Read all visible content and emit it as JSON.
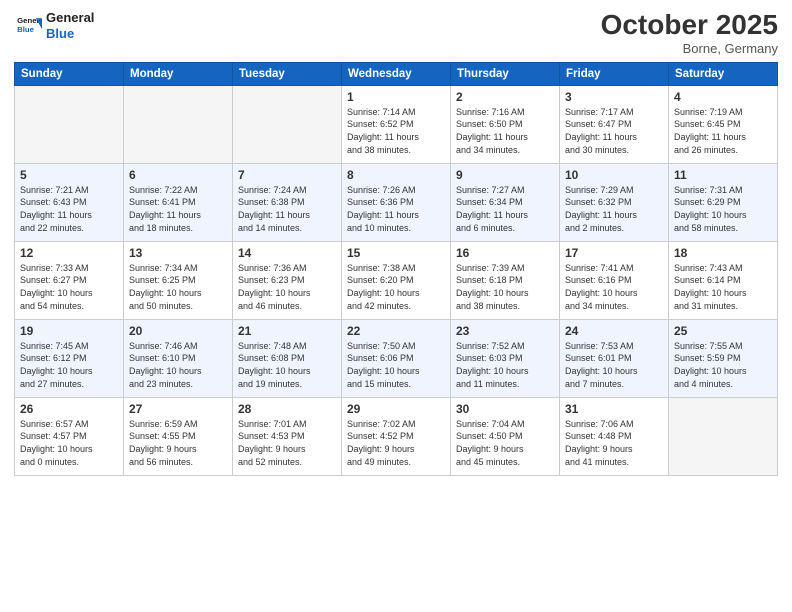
{
  "header": {
    "logo_line1": "General",
    "logo_line2": "Blue",
    "month": "October 2025",
    "location": "Borne, Germany"
  },
  "weekdays": [
    "Sunday",
    "Monday",
    "Tuesday",
    "Wednesday",
    "Thursday",
    "Friday",
    "Saturday"
  ],
  "weeks": [
    [
      {
        "day": "",
        "info": ""
      },
      {
        "day": "",
        "info": ""
      },
      {
        "day": "",
        "info": ""
      },
      {
        "day": "1",
        "info": "Sunrise: 7:14 AM\nSunset: 6:52 PM\nDaylight: 11 hours\nand 38 minutes."
      },
      {
        "day": "2",
        "info": "Sunrise: 7:16 AM\nSunset: 6:50 PM\nDaylight: 11 hours\nand 34 minutes."
      },
      {
        "day": "3",
        "info": "Sunrise: 7:17 AM\nSunset: 6:47 PM\nDaylight: 11 hours\nand 30 minutes."
      },
      {
        "day": "4",
        "info": "Sunrise: 7:19 AM\nSunset: 6:45 PM\nDaylight: 11 hours\nand 26 minutes."
      }
    ],
    [
      {
        "day": "5",
        "info": "Sunrise: 7:21 AM\nSunset: 6:43 PM\nDaylight: 11 hours\nand 22 minutes."
      },
      {
        "day": "6",
        "info": "Sunrise: 7:22 AM\nSunset: 6:41 PM\nDaylight: 11 hours\nand 18 minutes."
      },
      {
        "day": "7",
        "info": "Sunrise: 7:24 AM\nSunset: 6:38 PM\nDaylight: 11 hours\nand 14 minutes."
      },
      {
        "day": "8",
        "info": "Sunrise: 7:26 AM\nSunset: 6:36 PM\nDaylight: 11 hours\nand 10 minutes."
      },
      {
        "day": "9",
        "info": "Sunrise: 7:27 AM\nSunset: 6:34 PM\nDaylight: 11 hours\nand 6 minutes."
      },
      {
        "day": "10",
        "info": "Sunrise: 7:29 AM\nSunset: 6:32 PM\nDaylight: 11 hours\nand 2 minutes."
      },
      {
        "day": "11",
        "info": "Sunrise: 7:31 AM\nSunset: 6:29 PM\nDaylight: 10 hours\nand 58 minutes."
      }
    ],
    [
      {
        "day": "12",
        "info": "Sunrise: 7:33 AM\nSunset: 6:27 PM\nDaylight: 10 hours\nand 54 minutes."
      },
      {
        "day": "13",
        "info": "Sunrise: 7:34 AM\nSunset: 6:25 PM\nDaylight: 10 hours\nand 50 minutes."
      },
      {
        "day": "14",
        "info": "Sunrise: 7:36 AM\nSunset: 6:23 PM\nDaylight: 10 hours\nand 46 minutes."
      },
      {
        "day": "15",
        "info": "Sunrise: 7:38 AM\nSunset: 6:20 PM\nDaylight: 10 hours\nand 42 minutes."
      },
      {
        "day": "16",
        "info": "Sunrise: 7:39 AM\nSunset: 6:18 PM\nDaylight: 10 hours\nand 38 minutes."
      },
      {
        "day": "17",
        "info": "Sunrise: 7:41 AM\nSunset: 6:16 PM\nDaylight: 10 hours\nand 34 minutes."
      },
      {
        "day": "18",
        "info": "Sunrise: 7:43 AM\nSunset: 6:14 PM\nDaylight: 10 hours\nand 31 minutes."
      }
    ],
    [
      {
        "day": "19",
        "info": "Sunrise: 7:45 AM\nSunset: 6:12 PM\nDaylight: 10 hours\nand 27 minutes."
      },
      {
        "day": "20",
        "info": "Sunrise: 7:46 AM\nSunset: 6:10 PM\nDaylight: 10 hours\nand 23 minutes."
      },
      {
        "day": "21",
        "info": "Sunrise: 7:48 AM\nSunset: 6:08 PM\nDaylight: 10 hours\nand 19 minutes."
      },
      {
        "day": "22",
        "info": "Sunrise: 7:50 AM\nSunset: 6:06 PM\nDaylight: 10 hours\nand 15 minutes."
      },
      {
        "day": "23",
        "info": "Sunrise: 7:52 AM\nSunset: 6:03 PM\nDaylight: 10 hours\nand 11 minutes."
      },
      {
        "day": "24",
        "info": "Sunrise: 7:53 AM\nSunset: 6:01 PM\nDaylight: 10 hours\nand 7 minutes."
      },
      {
        "day": "25",
        "info": "Sunrise: 7:55 AM\nSunset: 5:59 PM\nDaylight: 10 hours\nand 4 minutes."
      }
    ],
    [
      {
        "day": "26",
        "info": "Sunrise: 6:57 AM\nSunset: 4:57 PM\nDaylight: 10 hours\nand 0 minutes."
      },
      {
        "day": "27",
        "info": "Sunrise: 6:59 AM\nSunset: 4:55 PM\nDaylight: 9 hours\nand 56 minutes."
      },
      {
        "day": "28",
        "info": "Sunrise: 7:01 AM\nSunset: 4:53 PM\nDaylight: 9 hours\nand 52 minutes."
      },
      {
        "day": "29",
        "info": "Sunrise: 7:02 AM\nSunset: 4:52 PM\nDaylight: 9 hours\nand 49 minutes."
      },
      {
        "day": "30",
        "info": "Sunrise: 7:04 AM\nSunset: 4:50 PM\nDaylight: 9 hours\nand 45 minutes."
      },
      {
        "day": "31",
        "info": "Sunrise: 7:06 AM\nSunset: 4:48 PM\nDaylight: 9 hours\nand 41 minutes."
      },
      {
        "day": "",
        "info": ""
      }
    ]
  ]
}
